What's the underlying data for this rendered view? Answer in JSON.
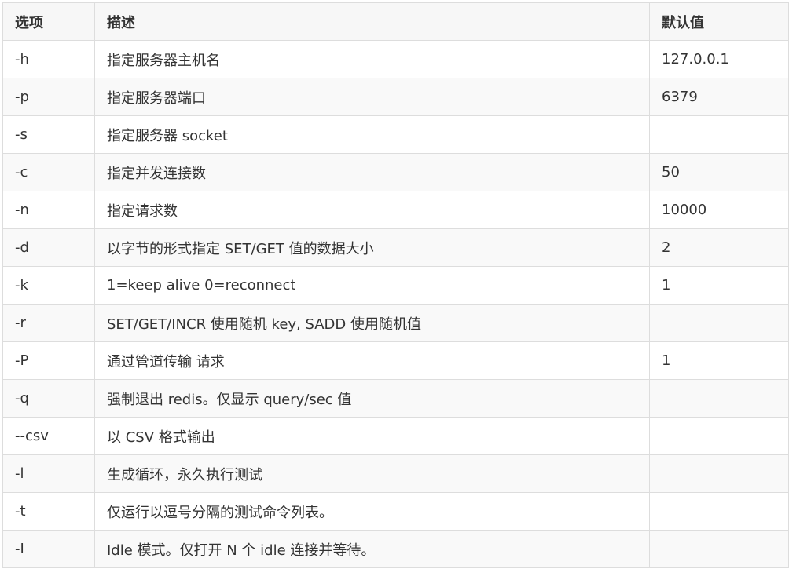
{
  "table": {
    "headers": [
      "选项",
      "描述",
      "默认值"
    ],
    "rows": [
      [
        "-h",
        "指定服务器主机名",
        "127.0.0.1"
      ],
      [
        "-p",
        "指定服务器端口",
        "6379"
      ],
      [
        "-s",
        "指定服务器 socket",
        ""
      ],
      [
        "-c",
        "指定并发连接数",
        "50"
      ],
      [
        "-n",
        "指定请求数",
        "10000"
      ],
      [
        "-d",
        "以字节的形式指定 SET/GET 值的数据大小",
        "2"
      ],
      [
        "-k",
        "1=keep alive 0=reconnect",
        "1"
      ],
      [
        "-r",
        "SET/GET/INCR 使用随机 key, SADD 使用随机值",
        ""
      ],
      [
        "-P",
        "通过管道传输 请求",
        "1"
      ],
      [
        "-q",
        "强制退出 redis。仅显示 query/sec 值",
        ""
      ],
      [
        "--csv",
        "以 CSV 格式输出",
        ""
      ],
      [
        "-l",
        "生成循环，永久执行测试",
        ""
      ],
      [
        "-t",
        "仅运行以逗号分隔的测试命令列表。",
        ""
      ],
      [
        "-I",
        "Idle 模式。仅打开 N 个 idle 连接并等待。",
        ""
      ]
    ]
  }
}
